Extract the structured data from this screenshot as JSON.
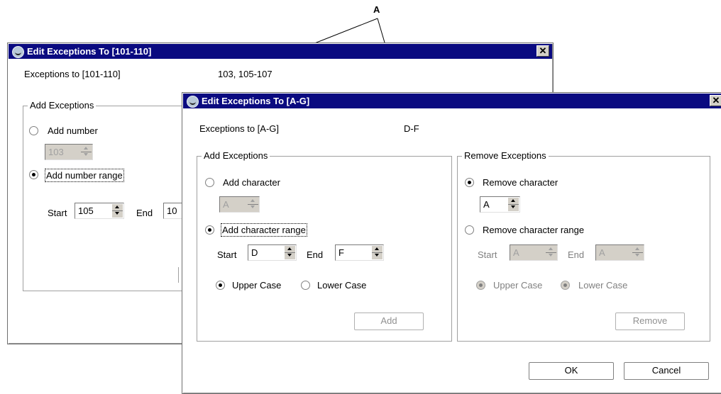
{
  "callout": "A",
  "win_back": {
    "title": "Edit Exceptions To [101-110]",
    "close": "✕",
    "exceptions_label": "Exceptions to [101-110]",
    "exceptions_value": "103, 105-107",
    "add_group": "Add Exceptions",
    "add_number_label": "Add number",
    "add_number_value": "103",
    "add_range_label": "Add number range",
    "start_label": "Start",
    "start_value": "105",
    "end_label": "End",
    "end_value": "10"
  },
  "win_front": {
    "title": "Edit Exceptions To [A-G]",
    "close": "✕",
    "exceptions_label": "Exceptions to [A-G]",
    "exceptions_value": "D-F",
    "add_group": {
      "title": "Add Exceptions",
      "add_character_label": "Add character",
      "add_character_value": "A",
      "add_range_label": "Add character range",
      "start_label": "Start",
      "start_value": "D",
      "end_label": "End",
      "end_value": "F",
      "upper_label": "Upper Case",
      "lower_label": "Lower Case",
      "add_button": "Add"
    },
    "remove_group": {
      "title": "Remove Exceptions",
      "remove_character_label": "Remove character",
      "remove_character_value": "A",
      "remove_range_label": "Remove character range",
      "start_label": "Start",
      "start_value": "A",
      "end_label": "End",
      "end_value": "A",
      "upper_label": "Upper Case",
      "lower_label": "Lower Case",
      "remove_button": "Remove"
    },
    "ok_button": "OK",
    "cancel_button": "Cancel"
  },
  "colors": {
    "titlebar": "#0a0a80",
    "disabled_text": "#808080",
    "face": "#d4d0c8"
  }
}
